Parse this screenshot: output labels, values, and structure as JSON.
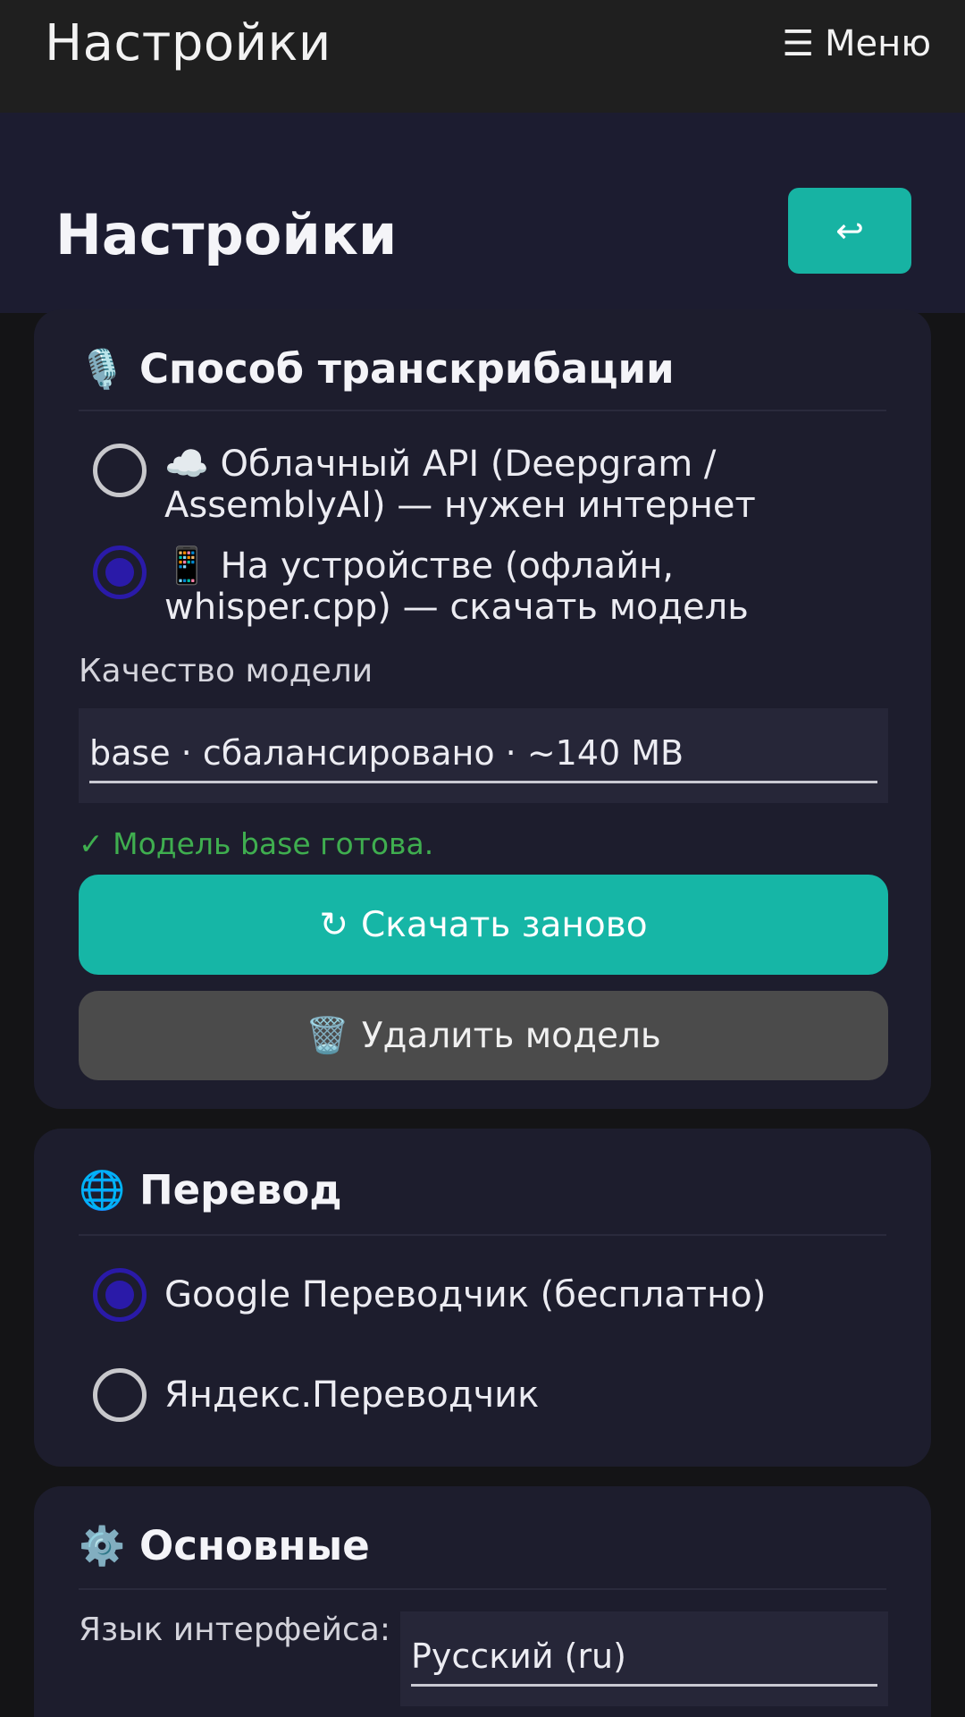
{
  "topbar": {
    "title": "Настройки",
    "menu_icon": "☰",
    "menu_label": "Меню"
  },
  "header": {
    "title": "Настройки",
    "back_icon": "↩"
  },
  "transcription": {
    "icon": "🎙️",
    "title": "Способ транскрибации",
    "options": [
      {
        "label": "☁️ Облачный API (Deepgram / AssemblyAI) — нужен интернет",
        "selected": false
      },
      {
        "label": "📱 На устройстве (офлайн, whisper.cpp) — скачать модель",
        "selected": true
      }
    ],
    "model_quality_label": "Качество модели",
    "model_quality_value": "base · сбалансировано · ~140 MB",
    "status": "✓ Модель base готова.",
    "status_color": "#3fae4f",
    "redownload_icon": "↻",
    "redownload_label": "Скачать заново",
    "delete_icon": "🗑️",
    "delete_label": "Удалить модель"
  },
  "translation": {
    "icon": "🌐",
    "title": "Перевод",
    "options": [
      {
        "label": "Google Переводчик (бесплатно)",
        "selected": true
      },
      {
        "label": "Яндекс.Переводчик",
        "selected": false
      }
    ]
  },
  "general": {
    "icon": "⚙️",
    "title": "Основные",
    "language_label": "Язык интерфейса:",
    "language_value": "Русский (ru)"
  },
  "colors": {
    "accent": "#17b3a3",
    "radio_selected": "#2a1aa8",
    "card_bg": "#1d1d2d",
    "header_bg": "#1c1c30",
    "page_bg": "#141416"
  }
}
